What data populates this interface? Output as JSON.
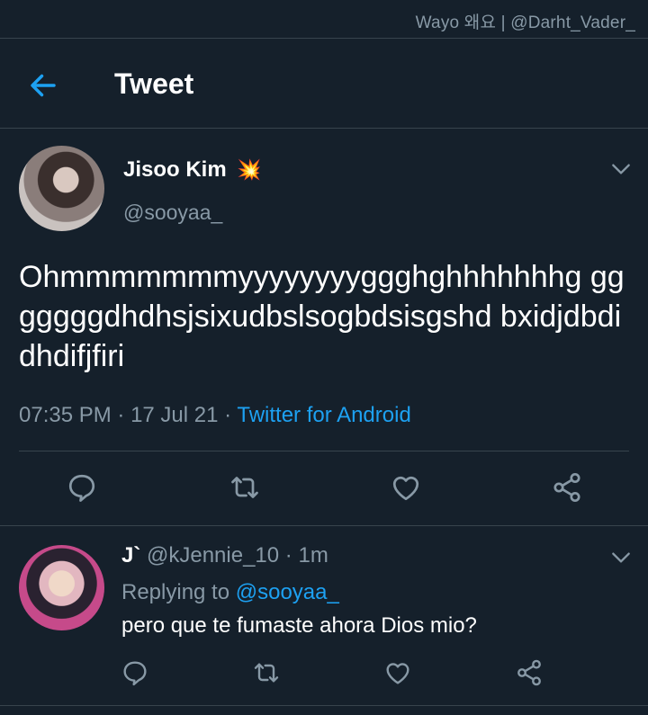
{
  "watermark": "Wayo 왜요 | @Darht_Vader_",
  "header": {
    "title": "Tweet",
    "back_icon": "arrow-left-icon"
  },
  "tweet": {
    "author_name": "Jisoo Kim",
    "author_emoji": "💥",
    "author_handle": "@sooyaa_",
    "text": "Ohmmmmmmmyyyyyyyyggghghhhhhhhg gggggggdhdhsjsixudbslsogbdsisgshd bxidjdbdidhdifjfiri",
    "time": "07:35 PM",
    "date": "17 Jul 21",
    "separator": " · ",
    "source": "Twitter for Android"
  },
  "reply": {
    "author_name": "J`",
    "author_handle": "@kJennie_10",
    "time": "1m",
    "separator": " · ",
    "replying_prefix": "Replying to ",
    "replying_to": "@sooyaa_",
    "text": "pero que te fumaste ahora Dios mio?"
  },
  "colors": {
    "background": "#15202b",
    "accent": "#1da1f2",
    "muted": "#8899a6",
    "divider": "#38444d"
  }
}
